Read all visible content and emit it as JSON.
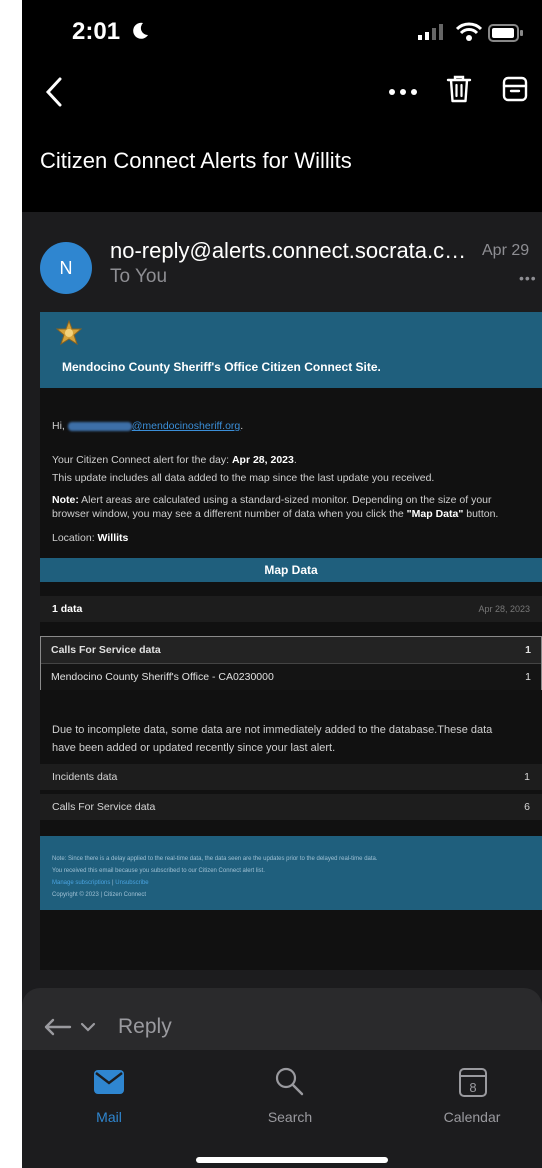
{
  "status": {
    "time": "2:01"
  },
  "email": {
    "subject": "Citizen Connect Alerts for Willits",
    "avatar_initial": "N",
    "from": "no-reply@alerts.connect.socrata.com",
    "to": "To You",
    "date": "Apr 29",
    "banner_title": "Mendocino County Sheriff's Office Citizen Connect Site.",
    "greeting_prefix": "Hi, ",
    "greeting_email_domain": "@mendocinosheriff.org",
    "alert_line_prefix": "Your Citizen Connect alert for the day: ",
    "alert_date": "Apr 28, 2023",
    "update_line": "This update includes all data added to the map since the last update you received.",
    "note_label": "Note:",
    "note_line1": " Alert areas are calculated using a standard-sized monitor. Depending on the size of your",
    "note_line2": "browser window, you may see a different number of data when you click the ",
    "note_button_ref": "\"Map Data\"",
    "note_line2_end": " button.",
    "location_label": "Location: ",
    "location_value": "Willits",
    "map_button": "Map Data",
    "summary": {
      "count": "1 data",
      "date": "Apr 28, 2023"
    },
    "table": [
      {
        "label": "Calls For Service data",
        "value": "1"
      },
      {
        "label": "Mendocino County Sheriff's Office - CA0230000",
        "value": "1"
      }
    ],
    "incomplete_line1": "Due to incomplete data, some data are not immediately added to the database.These data",
    "incomplete_line2": "have been added or updated recently since your last alert.",
    "updated": [
      {
        "label": "Incidents data",
        "value": "1"
      },
      {
        "label": "Calls For Service data",
        "value": "6"
      }
    ],
    "footer": {
      "line1": "Note: Since there is a delay applied to the real-time data, the data seen are the updates prior to the delayed real-time data.",
      "line2": "You received this email because you subscribed to our Citizen Connect alert list.",
      "manage": "Manage subscriptions",
      "sep": " | ",
      "unsubscribe": "Unsubscribe",
      "copyright": "Copyright © 2023 | Citizen Connect"
    }
  },
  "reply": {
    "label": "Reply"
  },
  "tabs": [
    {
      "label": "Mail"
    },
    {
      "label": "Search"
    },
    {
      "label": "Calendar",
      "badge": "8"
    }
  ],
  "colors": {
    "accent": "#2f86d0",
    "banner": "#1f5f7d"
  }
}
